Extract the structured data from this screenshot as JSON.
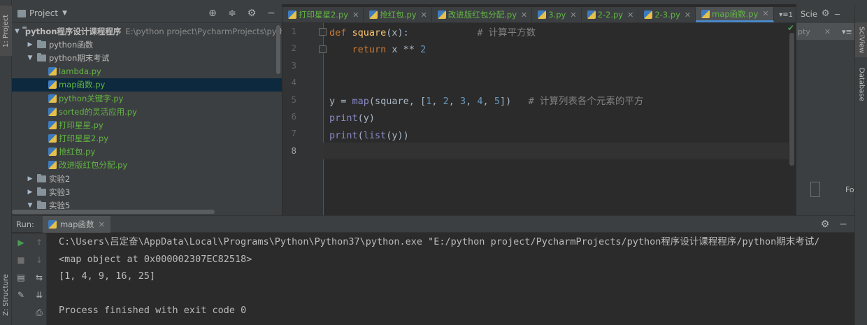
{
  "sidebar": {
    "project_tab": "1: Project",
    "structure_tab": "Z: Structure"
  },
  "project_panel": {
    "title": "Project",
    "tree": [
      {
        "label": "python程序设计课程程序",
        "path": "E:\\python project\\PycharmProjects\\pytho",
        "type": "folder",
        "expanded": true,
        "level": 0
      },
      {
        "label": "python函数",
        "type": "folder",
        "expanded": false,
        "level": 1
      },
      {
        "label": "python期末考试",
        "type": "folder",
        "expanded": true,
        "level": 1
      },
      {
        "label": "lambda.py",
        "type": "file",
        "level": 2
      },
      {
        "label": "map函数.py",
        "type": "file",
        "level": 2,
        "selected": true
      },
      {
        "label": "python关键字.py",
        "type": "file",
        "level": 2
      },
      {
        "label": "sorted的灵活应用.py",
        "type": "file",
        "level": 2
      },
      {
        "label": "打印星星.py",
        "type": "file",
        "level": 2
      },
      {
        "label": "打印星星2.py",
        "type": "file",
        "level": 2
      },
      {
        "label": "抢红包.py",
        "type": "file",
        "level": 2
      },
      {
        "label": "改进版红包分配.py",
        "type": "file",
        "level": 2
      },
      {
        "label": "实验2",
        "type": "folder",
        "expanded": false,
        "level": 1
      },
      {
        "label": "实验3",
        "type": "folder",
        "expanded": false,
        "level": 1
      },
      {
        "label": "实验5",
        "type": "folder",
        "expanded": true,
        "level": 1
      }
    ]
  },
  "tabs": [
    {
      "label": "打印星星2.py",
      "green": true,
      "active": false
    },
    {
      "label": "抢红包.py",
      "green": true,
      "active": false
    },
    {
      "label": "改进版红包分配.py",
      "green": true,
      "active": false
    },
    {
      "label": "3.py",
      "green": true,
      "active": false
    },
    {
      "label": "2-2.py",
      "green": true,
      "active": false
    },
    {
      "label": "2-3.py",
      "green": true,
      "active": false
    },
    {
      "label": "map函数.py",
      "green": true,
      "active": true
    }
  ],
  "tab_overflow": "▾≡1",
  "editor": {
    "line_numbers": [
      "1",
      "2",
      "3",
      "4",
      "5",
      "6",
      "7",
      "8"
    ],
    "current_line": 8
  },
  "sciview": {
    "title": "Scie",
    "side_tab": "SciView",
    "tab_text": "pty",
    "footer_text": "For"
  },
  "right_strip": {
    "sciview_tab": "SciView",
    "database_tab": "Database"
  },
  "run": {
    "label": "Run:",
    "tab_label": "map函数",
    "console": [
      "C:\\Users\\吕定奋\\AppData\\Local\\Programs\\Python\\Python37\\python.exe \"E:/python project/PycharmProjects/python程序设计课程程序/python期末考试/",
      "<map object at 0x000002307EC82518>",
      "[1, 4, 9, 16, 25]",
      "",
      "Process finished with exit code 0"
    ]
  },
  "colors": {
    "accent": "#4a88c7",
    "green_file": "#62b543",
    "keyword": "#cc7832",
    "function": "#ffc66d",
    "number": "#6897bb",
    "comment": "#808080"
  }
}
